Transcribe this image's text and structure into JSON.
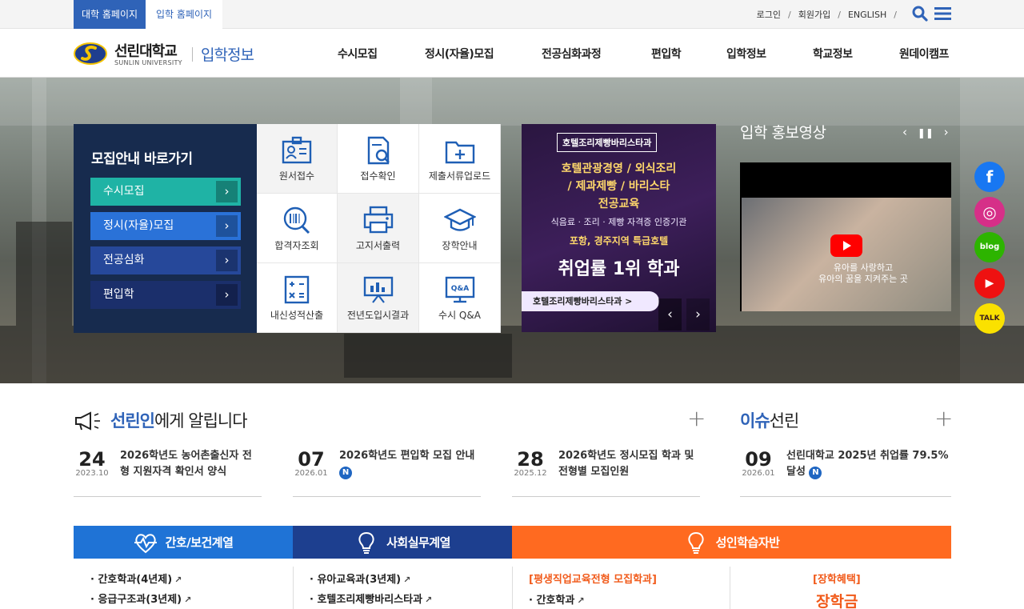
{
  "topbar": {
    "tabs": [
      "대학 홈페이지",
      "입학 홈페이지"
    ],
    "links": [
      "로그인",
      "회원가입",
      "ENGLISH"
    ]
  },
  "header": {
    "logo_kr": "선린대학교",
    "logo_en": "SUNLIN UNIVERSITY",
    "logo_sub": "입학정보",
    "nav": [
      "수시모집",
      "정시(자율)모집",
      "전공심화과정",
      "편입학",
      "입학정보",
      "학교정보",
      "원데이캠프"
    ]
  },
  "quick": {
    "title": "모집안내 바로가기",
    "buttons": [
      "수시모집",
      "정시(자율)모집",
      "전공심화",
      "편입학"
    ],
    "cells": [
      "원서접수",
      "접수확인",
      "제출서류업로드",
      "합격자조회",
      "고지서출력",
      "장학안내",
      "내신성적산출",
      "전년도입시결과",
      "수시 Q&A"
    ]
  },
  "banner": {
    "tag": "호텔조리제빵바리스타과",
    "line1": "호텔관광경영 / 외식조리",
    "line2": "/ 제과제빵 / 바리스타",
    "line3": "전공교육",
    "line4": "식음료 · 조리 · 제빵 자격증 인증기관",
    "line5": "포항, 경주지역 특급호텔",
    "line6": "취업률 1위 학과",
    "pill": "호텔조리제빵바리스타과 >"
  },
  "video": {
    "title": "입학 홍보영상",
    "caption_1": "유아를 사랑하고",
    "caption_2": "유아의 꿈을 지켜주는 곳"
  },
  "social": [
    "f",
    "◎",
    "blog",
    "▶",
    "TALK"
  ],
  "news_section": {
    "title_hl": "선린인",
    "title_rest": "에게 알립니다",
    "items": [
      {
        "day": "24",
        "ym": "2023.10",
        "text": "2026학년도 농어촌출신자 전형 지원자격 확인서 양식",
        "is_new": false
      },
      {
        "day": "07",
        "ym": "2026.01",
        "text": "2026학년도 편입학 모집 안내",
        "is_new": true
      },
      {
        "day": "28",
        "ym": "2025.12",
        "text": "2026학년도 정시모집 학과 및 전형별 모집인원",
        "is_new": false
      }
    ]
  },
  "issue_section": {
    "title_hl": "이슈",
    "title_rest": "선린",
    "item": {
      "day": "09",
      "ym": "2026.01",
      "text": "선린대학교 2025년 취업률 79.5% 달성",
      "is_new": true
    }
  },
  "new_badge": "N",
  "depts": {
    "nursing": {
      "title": "간호/보건계열",
      "items": [
        "간호학과(4년제)",
        "응급구조과(3년제)"
      ]
    },
    "social": {
      "title": "사회실무계열",
      "items": [
        "유아교육과(3년제)",
        "호텔조리제빵바리스타과"
      ]
    },
    "adult": {
      "title": "성인학습자반",
      "sub_title": "[평생직업교육전형 모집학과]",
      "items": [
        "간호학과"
      ],
      "sch_title": "[장학혜택]",
      "sch_text": "장학금"
    }
  },
  "colors": {
    "primary": "#2f63b8",
    "navy": "#172b4e",
    "teal": "#1fb3a5",
    "orange": "#ff6a20"
  }
}
